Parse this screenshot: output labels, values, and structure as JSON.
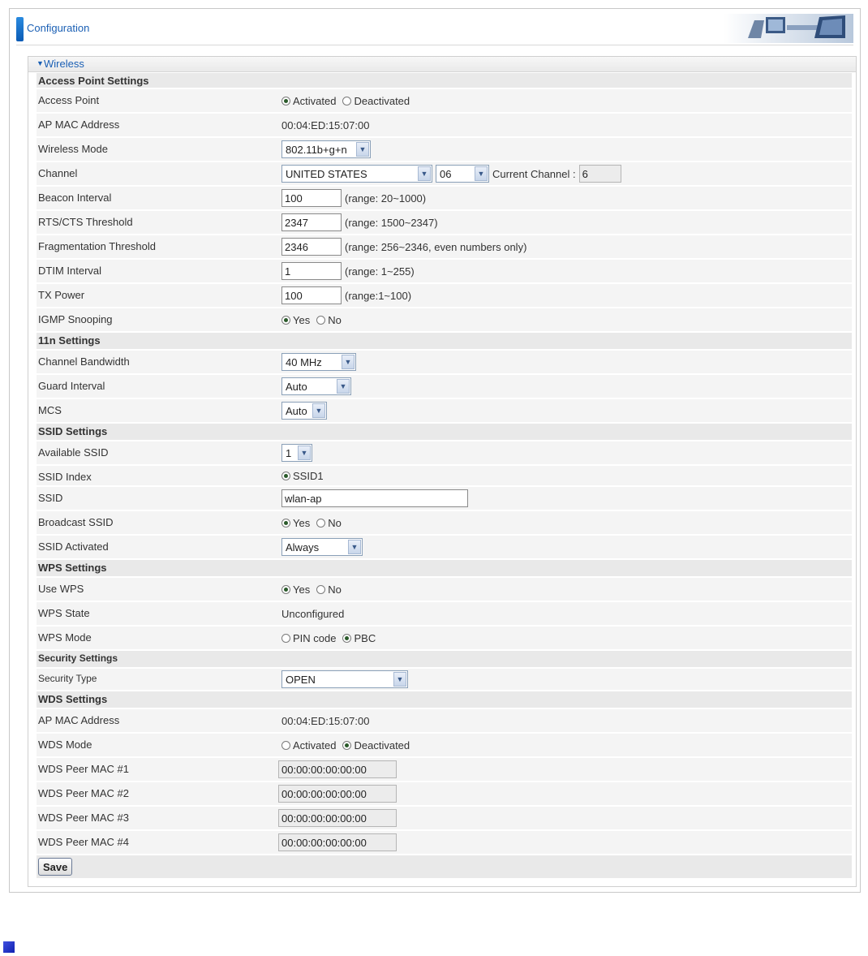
{
  "header": {
    "title": "Configuration"
  },
  "panel": {
    "title": "Wireless"
  },
  "rows": {
    "ap_section": "Access Point Settings",
    "access_point": {
      "label": "Access Point",
      "opt1": "Activated",
      "opt2": "Deactivated",
      "selected": "Activated"
    },
    "ap_mac": {
      "label": "AP MAC Address",
      "value": "00:04:ED:15:07:00"
    },
    "wireless_mode": {
      "label": "Wireless Mode",
      "value": "802.11b+g+n"
    },
    "channel": {
      "label": "Channel",
      "country": "UNITED STATES",
      "channel": "06",
      "current_label": "Current Channel :",
      "current_value": "6"
    },
    "beacon": {
      "label": "Beacon Interval",
      "value": "100",
      "hint": "(range: 20~1000)"
    },
    "rts": {
      "label": "RTS/CTS Threshold",
      "value": "2347",
      "hint": "(range: 1500~2347)"
    },
    "frag": {
      "label": "Fragmentation Threshold",
      "value": "2346",
      "hint": "(range: 256~2346, even numbers only)"
    },
    "dtim": {
      "label": "DTIM Interval",
      "value": "1",
      "hint": "(range: 1~255)"
    },
    "txpower": {
      "label": "TX Power",
      "value": "100",
      "hint": "(range:1~100)"
    },
    "igmp": {
      "label": "IGMP Snooping",
      "opt1": "Yes",
      "opt2": "No",
      "selected": "Yes"
    },
    "n_section": "11n Settings",
    "bandwidth": {
      "label": "Channel Bandwidth",
      "value": "40 MHz"
    },
    "guard": {
      "label": "Guard Interval",
      "value": "Auto"
    },
    "mcs": {
      "label": "MCS",
      "value": "Auto"
    },
    "ssid_section": "SSID Settings",
    "avail_ssid": {
      "label": "Available SSID",
      "value": "1"
    },
    "ssid_index": {
      "label": "SSID Index",
      "opt1": "SSID1"
    },
    "ssid": {
      "label": "SSID",
      "value": "wlan-ap"
    },
    "broadcast": {
      "label": "Broadcast SSID",
      "opt1": "Yes",
      "opt2": "No",
      "selected": "Yes"
    },
    "ssid_activated": {
      "label": "SSID Activated",
      "value": "Always"
    },
    "wps_section": "WPS Settings",
    "use_wps": {
      "label": "Use WPS",
      "opt1": "Yes",
      "opt2": "No",
      "selected": "Yes"
    },
    "wps_state": {
      "label": "WPS State",
      "value": "Unconfigured"
    },
    "wps_mode": {
      "label": "WPS Mode",
      "opt1": "PIN code",
      "opt2": "PBC",
      "selected": "PBC"
    },
    "sec_section": "Security Settings",
    "sec_type": {
      "label": "Security Type",
      "value": "OPEN"
    },
    "wds_section": "WDS Settings",
    "wds_ap_mac": {
      "label": "AP MAC Address",
      "value": "00:04:ED:15:07:00"
    },
    "wds_mode": {
      "label": "WDS Mode",
      "opt1": "Activated",
      "opt2": "Deactivated",
      "selected": "Deactivated"
    },
    "peer1": {
      "label": "WDS Peer MAC #1",
      "value": "00:00:00:00:00:00"
    },
    "peer2": {
      "label": "WDS Peer MAC #2",
      "value": "00:00:00:00:00:00"
    },
    "peer3": {
      "label": "WDS Peer MAC #3",
      "value": "00:00:00:00:00:00"
    },
    "peer4": {
      "label": "WDS Peer MAC #4",
      "value": "00:00:00:00:00:00"
    }
  },
  "save_label": "Save"
}
